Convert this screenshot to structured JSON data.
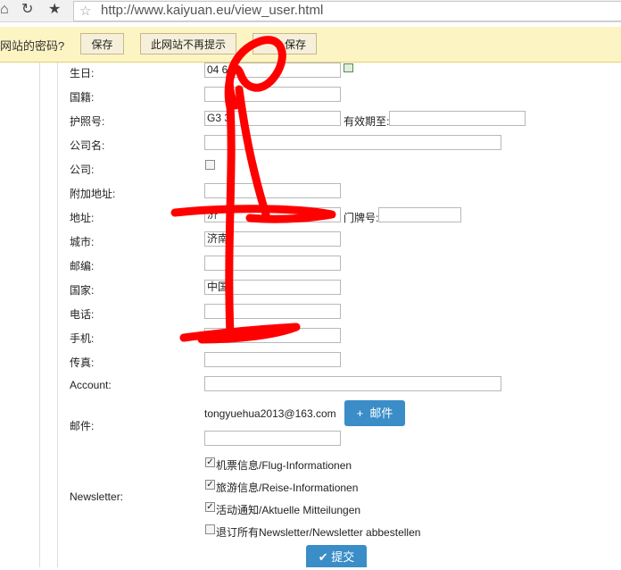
{
  "browser": {
    "back_icon": "home-icon",
    "url": "http://www.kaiyuan.eu/view_user.html"
  },
  "password_bar": {
    "question": "网站的密码?",
    "save_label": "保存",
    "never_label": "此网站不再提示",
    "never_save_label": "保存"
  },
  "form": {
    "birthday": {
      "label": "生日:",
      "value": "04   64"
    },
    "nationality": {
      "label": "国籍:",
      "value": ""
    },
    "passport": {
      "label": "护照号:",
      "value": "G3    3",
      "expiry_label": "有效期至:",
      "expiry_value": ""
    },
    "company_name": {
      "label": "公司名:",
      "value": ""
    },
    "company": {
      "label": "公司:"
    },
    "address_extra": {
      "label": "附加地址:",
      "value": ""
    },
    "address": {
      "label": "地址:",
      "value": "济",
      "house_no_label": "门牌号:",
      "house_no_value": ""
    },
    "city": {
      "label": "城市:",
      "value": "济南"
    },
    "zip": {
      "label": "邮编:",
      "value": ""
    },
    "country": {
      "label": "国家:",
      "value": "中国"
    },
    "phone": {
      "label": "电话:",
      "value": ""
    },
    "mobile": {
      "label": "手机:",
      "value": ""
    },
    "fax": {
      "label": "传真:",
      "value": ""
    },
    "account": {
      "label": "Account:",
      "value": ""
    },
    "email": {
      "label": "邮件:",
      "value": "tongyuehua2013@163.com",
      "add_button": "邮件",
      "new_value": ""
    },
    "newsletter": {
      "label": "Newsletter:",
      "options": [
        {
          "text": "机票信息/Flug-Informationen",
          "checked": true
        },
        {
          "text": "旅游信息/Reise-Informationen",
          "checked": true
        },
        {
          "text": "活动通知/Aktuelle Mitteilungen",
          "checked": true
        },
        {
          "text": "退订所有Newsletter/Newsletter abbestellen",
          "checked": false
        }
      ]
    },
    "submit_label": "提交"
  },
  "colors": {
    "accent": "#3a8dc7",
    "infobar": "#fdf4c4",
    "scribble": "#ff0000"
  }
}
